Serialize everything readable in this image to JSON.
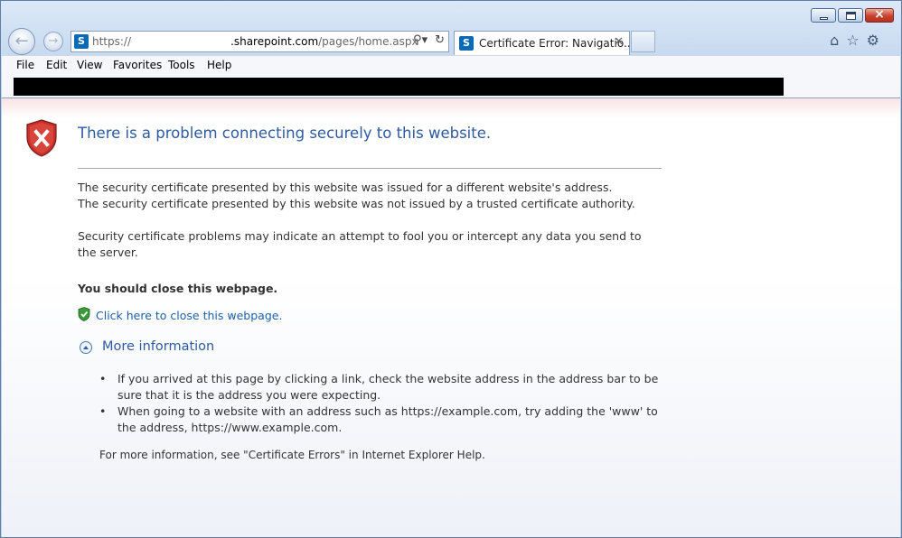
{
  "browser": {
    "address": {
      "scheme": "https://",
      "host": ".sharepoint.com",
      "path": "/pages/home.aspx",
      "site_icon": "sharepoint-icon",
      "site_icon_letter": "S"
    },
    "tab": {
      "title": "Certificate Error: Navigatio...",
      "close_glyph": "✕"
    },
    "menu": [
      "File",
      "Edit",
      "View",
      "Favorites",
      "Tools",
      "Help"
    ],
    "icons": [
      "back-icon",
      "forward-icon",
      "search-icon",
      "refresh-icon",
      "home-icon",
      "favorites-star-icon",
      "settings-gear-icon"
    ]
  },
  "page": {
    "title": "There is a problem connecting securely to this website.",
    "line1": "The security certificate presented by this website was issued for a different website's address.",
    "line2": "The security certificate presented by this website was not issued by a trusted certificate authority.",
    "line3": "Security certificate problems may indicate an attempt to fool you or intercept any data you send to the server.",
    "recommend": "You should close this webpage.",
    "close_link": "Click here to close this webpage.",
    "more_info": "More information",
    "bullets": [
      "If you arrived at this page by clicking a link, check the website address in the address bar to be sure that it is the address you were expecting.",
      "When going to a website with an address such as https://example.com, try adding the 'www' to the address, https://www.example.com."
    ],
    "help": "For more information, see \"Certificate Errors\" in Internet Explorer Help."
  },
  "colors": {
    "title_blue": "#2d5aa0",
    "link_blue": "#1e5fa8",
    "error_red": "#c8312b",
    "safe_green": "#3a9a3a"
  }
}
